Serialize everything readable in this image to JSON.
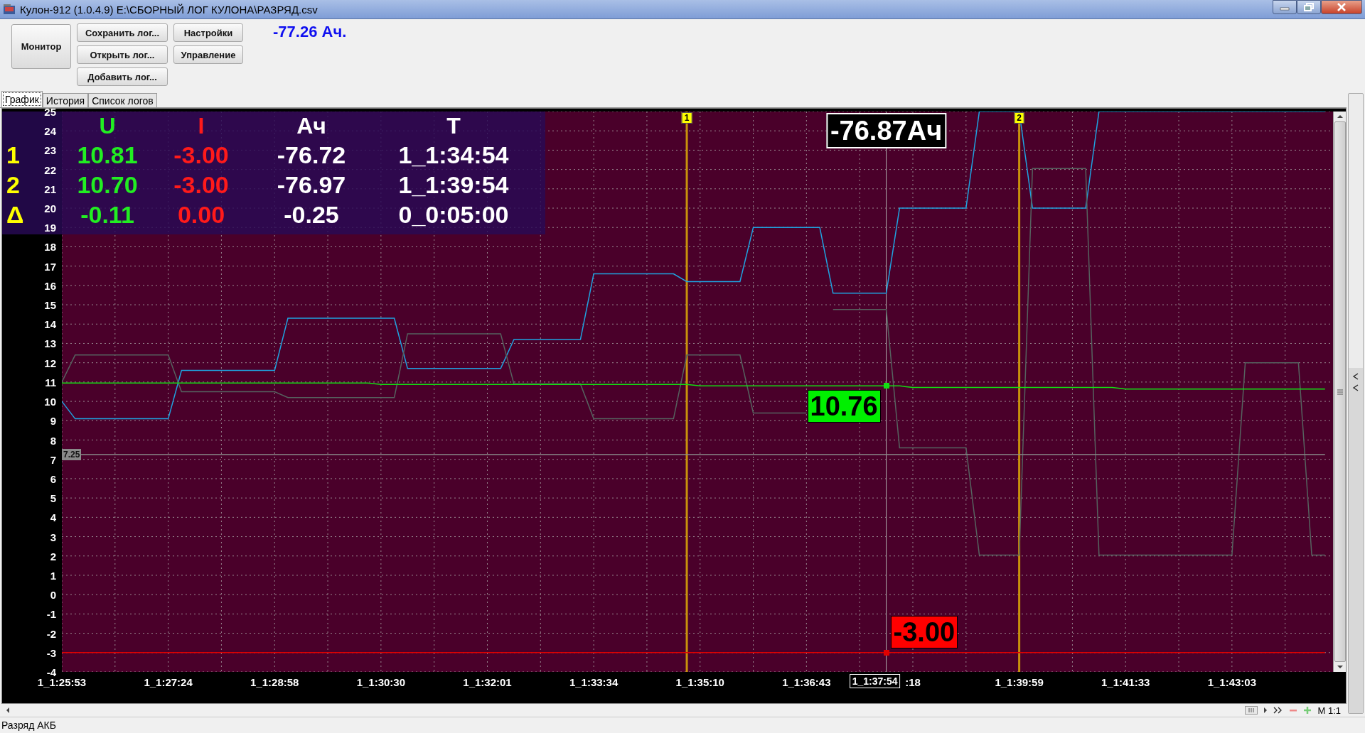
{
  "window": {
    "title": "Кулон-912 (1.0.4.9) E:\\СБОРНЫЙ ЛОГ КУЛОНА\\РАЗРЯД.csv"
  },
  "toolbar": {
    "monitor": "Монитор",
    "buttons_left": [
      "Сохранить лог...",
      "Открыть лог...",
      "Добавить лог..."
    ],
    "buttons_right": [
      "Настройки",
      "Управление"
    ],
    "total": "-77.26 Ач."
  },
  "tabs": [
    {
      "label": "График",
      "selected": true
    },
    {
      "label": "История",
      "selected": false
    },
    {
      "label": "Список логов",
      "selected": false
    }
  ],
  "readout": {
    "columns": [
      {
        "header": "U",
        "color": "#22ee22"
      },
      {
        "header": "I",
        "color": "#ff1a1a"
      },
      {
        "header": "Ач",
        "color": "#ffffff"
      },
      {
        "header": "T",
        "color": "#ffffff"
      }
    ],
    "rows": [
      {
        "label": "1",
        "cells": [
          "10.81",
          "-3.00",
          "-76.72",
          "1_1:34:54"
        ]
      },
      {
        "label": "2",
        "cells": [
          "10.70",
          "-3.00",
          "-76.97",
          "1_1:39:54"
        ]
      },
      {
        "label": "Δ",
        "cells": [
          "-0.11",
          "0.00",
          "-0.25",
          "0_0:05:00"
        ]
      }
    ]
  },
  "chart_data": {
    "type": "line",
    "categories": [
      "1_1:25:53",
      null,
      null,
      null,
      null,
      null,
      null,
      null,
      "1_1:27:24",
      null,
      null,
      null,
      null,
      null,
      null,
      null,
      "1_1:28:58",
      null,
      null,
      null,
      null,
      null,
      null,
      null,
      "1_1:30:30",
      null,
      null,
      null,
      null,
      null,
      null,
      null,
      "1_1:32:01",
      null,
      null,
      null,
      null,
      null,
      null,
      null,
      "1_1:33:34",
      null,
      null,
      null,
      null,
      null,
      null,
      null,
      "1_1:35:10",
      null,
      null,
      null,
      null,
      null,
      null,
      null,
      "1_1:36:43",
      null,
      null,
      null,
      null,
      null,
      null,
      null,
      ":18",
      null,
      null,
      null,
      null,
      null,
      null,
      null,
      "1_1:39:59",
      null,
      null,
      null,
      null,
      null,
      null,
      null,
      "1_1:41:33",
      null,
      null,
      null,
      null,
      null,
      null,
      null,
      "1_1:43:03",
      null,
      null,
      null,
      null,
      null,
      null,
      null
    ],
    "ylim": [
      -4,
      25
    ],
    "grid": true,
    "yticks": [
      -4,
      -3,
      -2,
      -1,
      0,
      1,
      2,
      3,
      4,
      5,
      6,
      7,
      8,
      9,
      10,
      11,
      12,
      13,
      14,
      15,
      16,
      17,
      18,
      19,
      20,
      21,
      22,
      23,
      24,
      25
    ],
    "series": [
      {
        "color": "#1fa3e0",
        "values": [
          10.0,
          9.1,
          9.1,
          9.1,
          9.1,
          9.1,
          9.1,
          9.1,
          9.1,
          11.6,
          11.6,
          11.6,
          11.6,
          11.6,
          11.6,
          11.6,
          11.6,
          14.3,
          14.3,
          14.3,
          14.3,
          14.3,
          14.3,
          14.3,
          14.3,
          14.3,
          11.7,
          11.7,
          11.7,
          11.7,
          11.7,
          11.7,
          11.7,
          11.7,
          13.2,
          13.2,
          13.2,
          13.2,
          13.2,
          13.2,
          16.6,
          16.6,
          16.6,
          16.6,
          16.6,
          16.6,
          16.6,
          16.2,
          16.2,
          16.2,
          16.2,
          16.2,
          19.0,
          19.0,
          19.0,
          19.0,
          19.0,
          19.0,
          15.6,
          15.6,
          15.6,
          15.6,
          15.6,
          20.0,
          20.0,
          20.0,
          20.0,
          20.0,
          20.0,
          25,
          25,
          25,
          25,
          20.0,
          20.0,
          20.0,
          20.0,
          20.0,
          25,
          25,
          25,
          25,
          25,
          25,
          25,
          25,
          25,
          25,
          25,
          25,
          25,
          25,
          25,
          25,
          25,
          25
        ]
      },
      {
        "color": "#56625f",
        "values": [
          11.0,
          12.4,
          12.4,
          12.4,
          12.4,
          12.4,
          12.4,
          12.4,
          12.4,
          10.5,
          10.5,
          10.5,
          10.5,
          10.5,
          10.5,
          10.5,
          10.5,
          10.2,
          10.2,
          10.2,
          10.2,
          10.2,
          10.2,
          10.2,
          10.2,
          10.2,
          13.5,
          13.5,
          13.5,
          13.5,
          13.5,
          13.5,
          13.5,
          13.5,
          10.9,
          10.9,
          10.9,
          10.9,
          10.9,
          10.9,
          9.1,
          9.1,
          9.1,
          9.1,
          9.1,
          9.1,
          9.1,
          12.4,
          12.4,
          12.4,
          12.4,
          12.4,
          9.4,
          9.4,
          9.4,
          9.4,
          9.4,
          null,
          14.75,
          14.75,
          14.75,
          14.75,
          14.75,
          7.6,
          7.6,
          7.6,
          7.6,
          7.6,
          7.6,
          2.05,
          2.05,
          2.05,
          2.05,
          22.05,
          22.05,
          22.05,
          22.05,
          22.05,
          2.05,
          2.05,
          2.05,
          2.05,
          2.05,
          2.05,
          2.05,
          2.05,
          2.05,
          2.05,
          2.05,
          12.0,
          12.0,
          12.0,
          12.0,
          12.0,
          2.05,
          2.05
        ]
      },
      {
        "color": "#12e012",
        "values": [
          10.95,
          10.95,
          10.95,
          10.95,
          10.95,
          10.95,
          10.95,
          10.95,
          10.95,
          10.95,
          10.95,
          10.95,
          10.95,
          10.95,
          10.95,
          10.95,
          10.95,
          10.95,
          10.95,
          10.95,
          10.95,
          10.95,
          10.95,
          10.95,
          10.88,
          10.88,
          10.88,
          10.88,
          10.88,
          10.88,
          10.88,
          10.88,
          10.88,
          10.88,
          10.88,
          10.88,
          10.88,
          10.88,
          10.88,
          10.88,
          10.88,
          10.88,
          10.88,
          10.88,
          10.88,
          10.88,
          10.88,
          10.88,
          10.8,
          10.8,
          10.8,
          10.8,
          10.8,
          10.8,
          10.8,
          10.8,
          10.8,
          10.8,
          10.8,
          10.8,
          10.8,
          10.8,
          10.8,
          10.8,
          10.72,
          10.72,
          10.72,
          10.72,
          10.72,
          10.72,
          10.72,
          10.72,
          10.72,
          10.72,
          10.72,
          10.72,
          10.72,
          10.72,
          10.72,
          10.72,
          10.64,
          10.64,
          10.64,
          10.64,
          10.64,
          10.64,
          10.64,
          10.64,
          10.64,
          10.64,
          10.64,
          10.64,
          10.64,
          10.64,
          10.64,
          10.64
        ]
      },
      {
        "color": "#e00000",
        "values": [
          -3,
          -3,
          -3,
          -3,
          -3,
          -3,
          -3,
          -3,
          -3,
          -3,
          -3,
          -3,
          -3,
          -3,
          -3,
          -3,
          -3,
          -3,
          -3,
          -3,
          -3,
          -3,
          -3,
          -3,
          -3,
          -3,
          -3,
          -3,
          -3,
          -3,
          -3,
          -3,
          -3,
          -3,
          -3,
          -3,
          -3,
          -3,
          -3,
          -3,
          -3,
          -3,
          -3,
          -3,
          -3,
          -3,
          -3,
          -3,
          -3,
          -3,
          -3,
          -3,
          -3,
          -3,
          -3,
          -3,
          -3,
          -3,
          -3,
          -3,
          -3,
          -3,
          -3,
          -3,
          -3,
          -3,
          -3,
          -3,
          -3,
          -3,
          -3,
          -3,
          -3,
          -3,
          -3,
          -3,
          -3,
          -3,
          -3,
          -3,
          -3,
          -3,
          -3,
          -3,
          -3,
          -3,
          -3,
          -3,
          -3,
          -3,
          -3,
          -3,
          -3,
          -3,
          -3,
          -3
        ]
      },
      {
        "color": "#8a8a8a",
        "values": [
          7.25,
          7.25,
          7.25,
          7.25,
          7.25,
          7.25,
          7.25,
          7.25,
          7.25,
          7.25,
          7.25,
          7.25,
          7.25,
          7.25,
          7.25,
          7.25,
          7.25,
          7.25,
          7.25,
          7.25,
          7.25,
          7.25,
          7.25,
          7.25,
          7.25,
          7.25,
          7.25,
          7.25,
          7.25,
          7.25,
          7.25,
          7.25,
          7.25,
          7.25,
          7.25,
          7.25,
          7.25,
          7.25,
          7.25,
          7.25,
          7.25,
          7.25,
          7.25,
          7.25,
          7.25,
          7.25,
          7.25,
          7.25,
          7.25,
          7.25,
          7.25,
          7.25,
          7.25,
          7.25,
          7.25,
          7.25,
          7.25,
          7.25,
          7.25,
          7.25,
          7.25,
          7.25,
          7.25,
          7.25,
          7.25,
          7.25,
          7.25,
          7.25,
          7.25,
          7.25,
          7.25,
          7.25,
          7.25,
          7.25,
          7.25,
          7.25,
          7.25,
          7.25,
          7.25,
          7.25,
          7.25,
          7.25,
          7.25,
          7.25,
          7.25,
          7.25,
          7.25,
          7.25,
          7.25,
          7.25,
          7.25,
          7.25,
          7.25,
          7.25,
          7.25,
          7.25
        ]
      }
    ]
  },
  "markers": {
    "reference_label": "7.25",
    "cursor_labels": [
      "1",
      "2"
    ],
    "probe": {
      "capacity": "-76.87Ач",
      "voltage": "10.76",
      "current": "-3.00",
      "time": "1_1:37:54"
    }
  },
  "scale_label": "M 1:1",
  "status_bar": "Разряд АКБ"
}
